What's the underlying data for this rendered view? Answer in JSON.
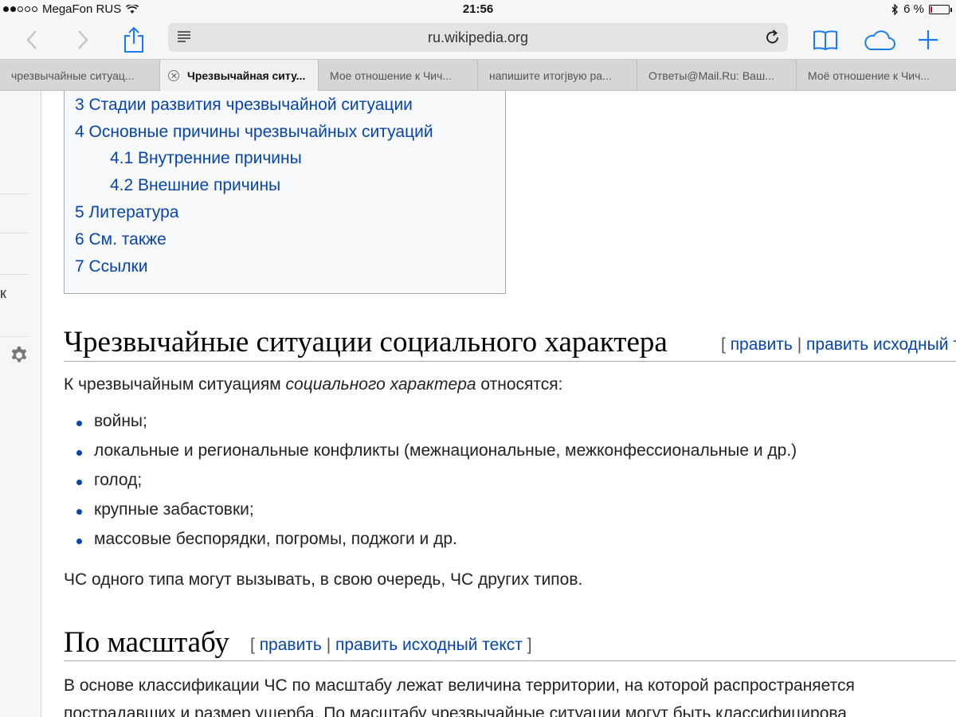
{
  "status_bar": {
    "carrier": "MegaFon RUS",
    "time": "21:56",
    "battery_percent": "6 %",
    "battery_level": 0.06
  },
  "toolbar": {
    "url": "ru.wikipedia.org"
  },
  "tabs": [
    {
      "label": "чрезвычайные ситуац...",
      "active": false
    },
    {
      "label": "Чрезвычайная ситу...",
      "active": true
    },
    {
      "label": "Мое отношение к Чич...",
      "active": false
    },
    {
      "label": "напишите итогjвую ра...",
      "active": false
    },
    {
      "label": "Ответы@Mail.Ru: Ваш...",
      "active": false
    },
    {
      "label": "Моё отношение к Чич...",
      "active": false
    }
  ],
  "sidebar": {
    "fragment": "к"
  },
  "toc": {
    "items": [
      "3 Стадии развития чрезвычайной ситуации",
      "4 Основные причины чрезвычайных ситуаций",
      "4.1 Внутренние причины",
      "4.2 Внешние причины",
      "5 Литература",
      "6 См. также",
      "7 Ссылки"
    ]
  },
  "section1": {
    "heading": "Чрезвычайные ситуации социального характера",
    "edit_open": "[",
    "edit_link": "править",
    "edit_sep": "|",
    "edit_source": "править исходный текст",
    "intro_before": "К чрезвычайным ситуациям ",
    "intro_em": "социального характера",
    "intro_after": " относятся:",
    "bullets": [
      "войны;",
      "локальные и региональные конфликты (межнациональные, межконфессиональные и др.)",
      "голод;",
      "крупные забастовки;",
      "массовые беспорядки, погромы, поджоги и др."
    ],
    "note": "ЧС одного типа могут вызывать, в свою очередь, ЧС других типов."
  },
  "section2": {
    "heading": "По масштабу",
    "edit_open": "[",
    "edit_link": "править",
    "edit_sep": "|",
    "edit_source": "править исходный текст",
    "edit_close": "]",
    "para_line1": "В основе классификации ЧС по масштабу лежат величина территории, на которой распространяется",
    "para_line2": "пострадавших и размер ущерба. По масштабу чрезвычайные ситуации могут быть классифицирова"
  }
}
